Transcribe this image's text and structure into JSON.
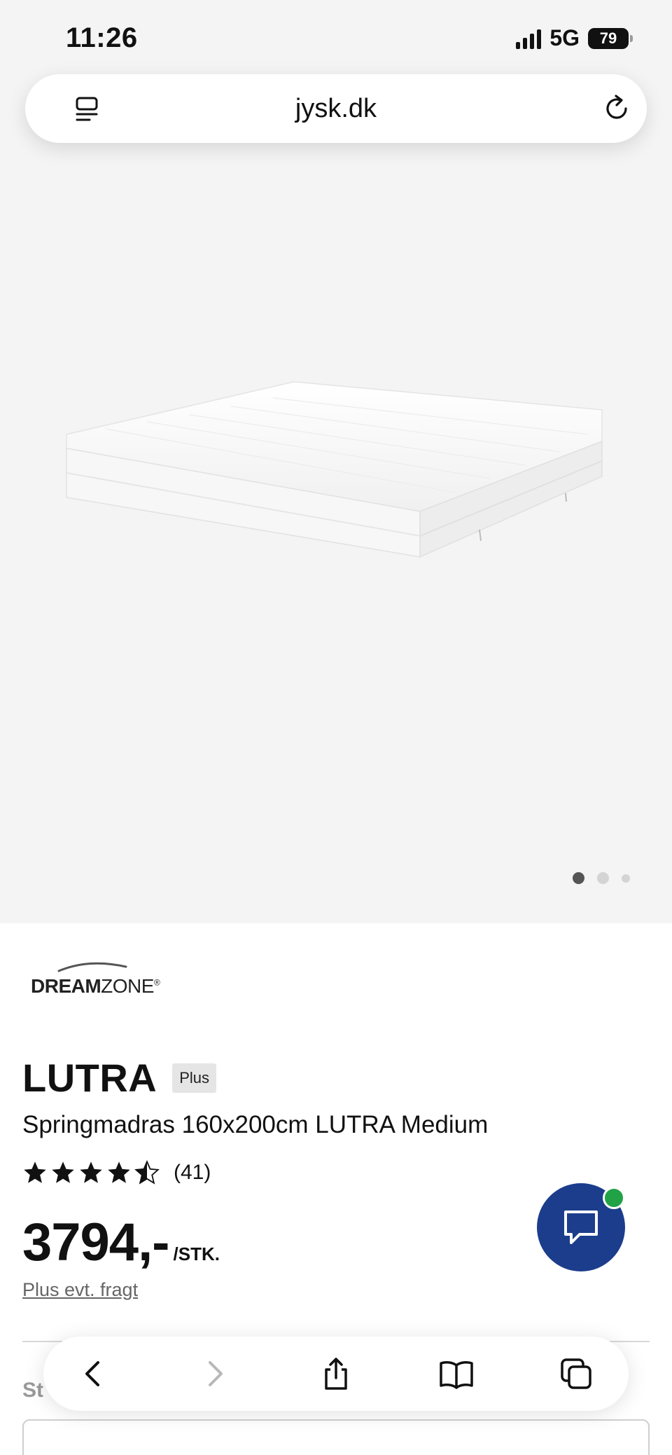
{
  "status_bar": {
    "time": "11:26",
    "network": "5G",
    "battery": "79"
  },
  "browser": {
    "url": "jysk.dk",
    "left_icon": "reader-menu-icon",
    "right_icon": "reload-icon"
  },
  "gallery": {
    "image_alt": "mattress-image",
    "dots_count": 3,
    "active_index": 0
  },
  "product": {
    "brand": "DREAMZONE",
    "name": "LUTRA",
    "badge": "Plus",
    "description": "Springmadras 160x200cm LUTRA Medium",
    "rating": 4.5,
    "review_count": "(41)",
    "price": "3794,-",
    "price_unit": "/STK.",
    "shipping_note": "Plus evt. fragt",
    "next_section_label": "St"
  },
  "chat": {
    "icon": "chat-bubble-icon",
    "status_color": "#22a246"
  },
  "toolbar": {
    "buttons": [
      "back-icon",
      "forward-icon",
      "share-icon",
      "bookmarks-icon",
      "tabs-icon"
    ]
  },
  "colors": {
    "accent": "#1c3d8c",
    "hero_background": "#f4f4f4"
  }
}
